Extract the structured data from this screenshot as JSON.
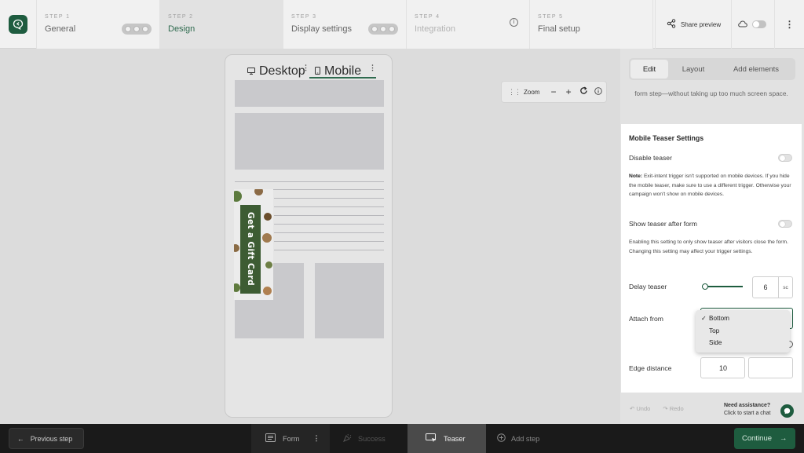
{
  "topbar": {
    "logo_icon": "chat-bubble-logo-icon",
    "steps": [
      {
        "num": "STEP 1",
        "name": "General"
      },
      {
        "num": "STEP 2",
        "name": "Design"
      },
      {
        "num": "STEP 3",
        "name": "Display settings"
      },
      {
        "num": "STEP 4",
        "name": "Integration"
      },
      {
        "num": "STEP 5",
        "name": "Final setup"
      }
    ],
    "share_label": "Share preview"
  },
  "canvas": {
    "tab_desktop": "Desktop",
    "tab_mobile": "Mobile",
    "teaser_text": "Get a Gift Card",
    "zoom_label": "Zoom"
  },
  "panel": {
    "tabs": [
      "Edit",
      "Layout",
      "Add elements"
    ],
    "intro": "form step—without taking up too much screen space.",
    "section_title": "Mobile Teaser Settings",
    "disable_teaser_label": "Disable teaser",
    "note_bold": "Note:",
    "note_text": " Exit-intent trigger isn't supported on mobile devices. If you hide the mobile teaser, make sure to use a different trigger. Otherwise your campaign won't show on mobile devices.",
    "show_after_form_label": "Show teaser after form",
    "show_after_form_note": "Enabling this setting to only show teaser after visitors close the form. Changing this setting may affect your trigger settings.",
    "delay_label": "Delay teaser",
    "delay_value": "6",
    "delay_unit": "sc",
    "attach_label": "Attach from",
    "attach_options": [
      "Bottom",
      "Top",
      "Side"
    ],
    "attach_checkmark": "✓",
    "edge_label": "Edge distance",
    "edge_value": "10",
    "undo": "Undo",
    "redo": "Redo",
    "assist_title": "Need assistance?",
    "assist_sub": "Click to start a chat"
  },
  "bottombar": {
    "prev_label": "Previous step",
    "tabs": [
      "Form",
      "Success",
      "Teaser",
      "Add step"
    ],
    "continue_label": "Continue"
  },
  "colors": {
    "brand_green": "#1e5c3f",
    "active_step_text": "#2f6b4f",
    "teaser_band": "#3d5c33"
  }
}
